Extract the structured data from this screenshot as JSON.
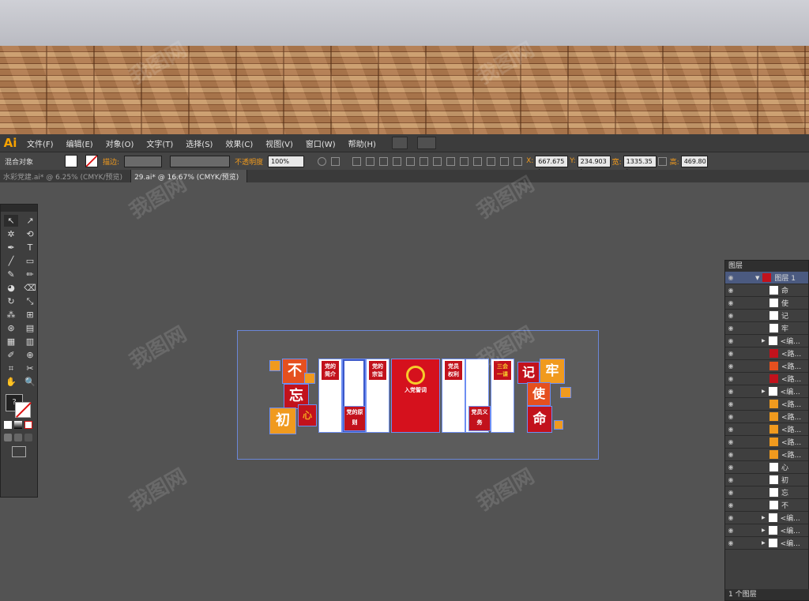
{
  "app": {
    "logo": "Ai"
  },
  "menu": [
    "文件(F)",
    "编辑(E)",
    "对象(O)",
    "文字(T)",
    "选择(S)",
    "效果(C)",
    "视图(V)",
    "窗口(W)",
    "帮助(H)"
  ],
  "control_bar": {
    "selection_label": "混合对象",
    "stroke_label": "描边:",
    "opacity_label": "不透明度",
    "opacity_value": "100%",
    "x_label": "X:",
    "x_value": "667.675 I",
    "y_label": "Y:",
    "y_value": "234.903 I",
    "w_label": "宽:",
    "w_value": "1335.35 I",
    "h_label": "高:",
    "h_value": "469.80"
  },
  "tabs": [
    {
      "label": "水彩党建.ai* @ 6.25% (CMYK/预览)"
    },
    {
      "label": "29.ai* @ 16.67% (CMYK/预览)"
    }
  ],
  "tools": [
    "↖",
    "↗",
    "✲",
    "⟲",
    "✒",
    "T",
    "╱",
    "▭",
    "✎",
    "✏",
    "◕",
    "⌫",
    "↻",
    "⤡",
    "⁂",
    "⊞",
    "⊛",
    "▤",
    "▦",
    "▥",
    "✐",
    "⊕",
    "⌗",
    "✂",
    "✋",
    "🔍"
  ],
  "artwork": {
    "chars": [
      "不",
      "忘",
      "初",
      "心",
      "记",
      "牢",
      "使",
      "命"
    ],
    "titles": [
      "党的简介",
      "党的宗旨",
      "入党誓词",
      "党员权利",
      "三会一课",
      "党的原则",
      "党员义务"
    ]
  },
  "layers_panel": {
    "tab": "图层",
    "layer_name": "图层 1",
    "rows": [
      "命",
      "使",
      "记",
      "牢",
      "<编...",
      "<路...",
      "<路...",
      "<路...",
      "<编...",
      "<路...",
      "<路...",
      "<路...",
      "<路...",
      "<路...",
      "心",
      "初",
      "忘",
      "不",
      "<编...",
      "<编...",
      "<编..."
    ],
    "footer": "1 个图层"
  },
  "watermark": "我图网"
}
